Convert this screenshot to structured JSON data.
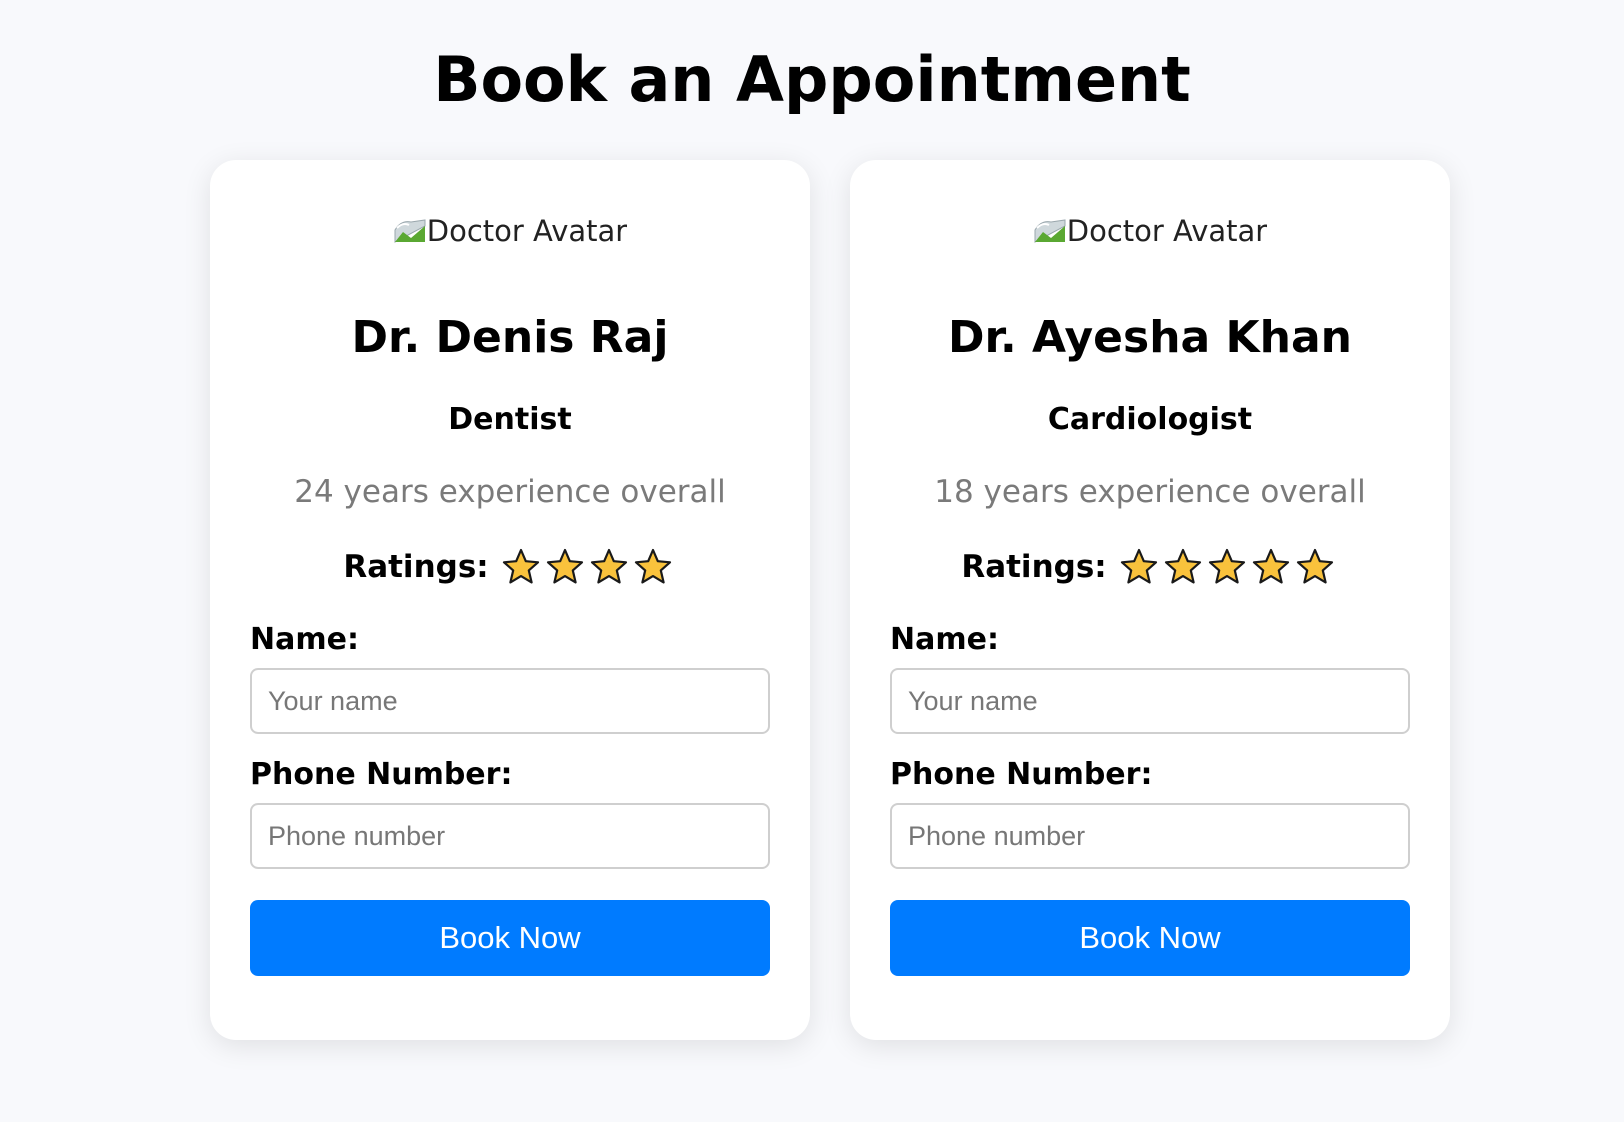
{
  "page": {
    "title": "Book an Appointment"
  },
  "doctors": [
    {
      "avatar_alt": "Doctor Avatar",
      "name": "Dr. Denis Raj",
      "specialty": "Dentist",
      "experience": "24 years experience overall",
      "ratings_label": "Ratings:",
      "rating": 4,
      "name_label": "Name:",
      "name_placeholder": "Your name",
      "name_value": "",
      "phone_label": "Phone Number:",
      "phone_placeholder": "Phone number",
      "phone_value": "",
      "button_label": "Book Now"
    },
    {
      "avatar_alt": "Doctor Avatar",
      "name": "Dr. Ayesha Khan",
      "specialty": "Cardiologist",
      "experience": "18 years experience overall",
      "ratings_label": "Ratings:",
      "rating": 5,
      "name_label": "Name:",
      "name_placeholder": "Your name",
      "name_value": "",
      "phone_label": "Phone Number:",
      "phone_placeholder": "Phone number",
      "phone_value": "",
      "button_label": "Book Now"
    }
  ],
  "icons": {
    "avatar": "broken-image-icon",
    "star": "star-icon"
  },
  "colors": {
    "background": "#f8f9fc",
    "card": "#ffffff",
    "button": "#007bff",
    "button_text": "#ffffff",
    "experience_text": "#7a7a7a",
    "star_fill": "#f9c23c",
    "star_stroke": "#1a1a1a"
  }
}
